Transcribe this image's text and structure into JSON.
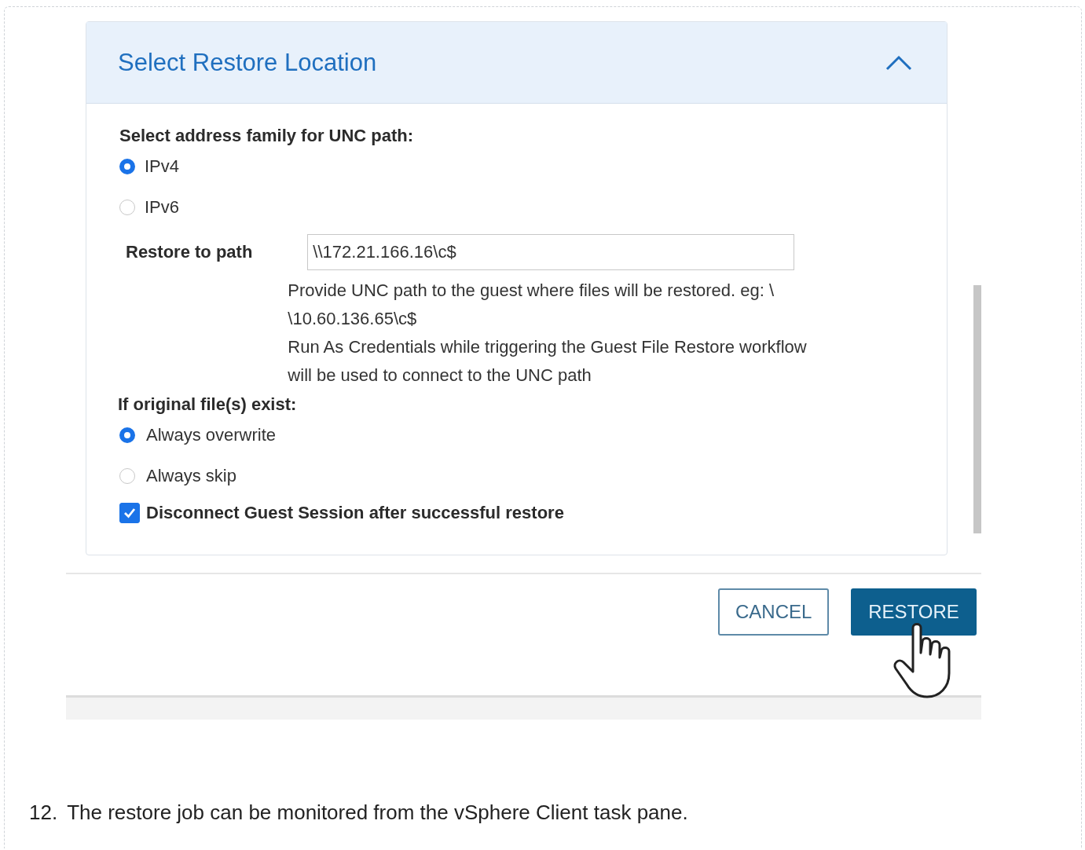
{
  "panel": {
    "title": "Select Restore Location",
    "expanded": true
  },
  "address_family": {
    "label": "Select address family for UNC path:",
    "options": [
      {
        "label": "IPv4",
        "selected": true
      },
      {
        "label": "IPv6",
        "selected": false
      }
    ]
  },
  "restore_path": {
    "label": "Restore to path",
    "value": "\\\\172.21.166.16\\c$",
    "help": [
      "Provide UNC path to the guest where files will be restored. eg: \\",
      "\\10.60.136.65\\c$",
      "Run As Credentials while triggering the Guest File Restore workflow",
      "will be used to connect to the UNC path"
    ]
  },
  "if_exists": {
    "label": "If original file(s) exist:",
    "options": [
      {
        "label": "Always overwrite",
        "selected": true
      },
      {
        "label": "Always skip",
        "selected": false
      }
    ]
  },
  "disconnect": {
    "label": "Disconnect Guest Session after successful restore",
    "checked": true
  },
  "buttons": [
    {
      "label": "CANCEL",
      "kind": "secondary"
    },
    {
      "label": "RESTORE",
      "kind": "primary"
    }
  ],
  "caption": {
    "number": "12.",
    "text": "The restore job can be monitored from the vSphere Client task pane."
  }
}
